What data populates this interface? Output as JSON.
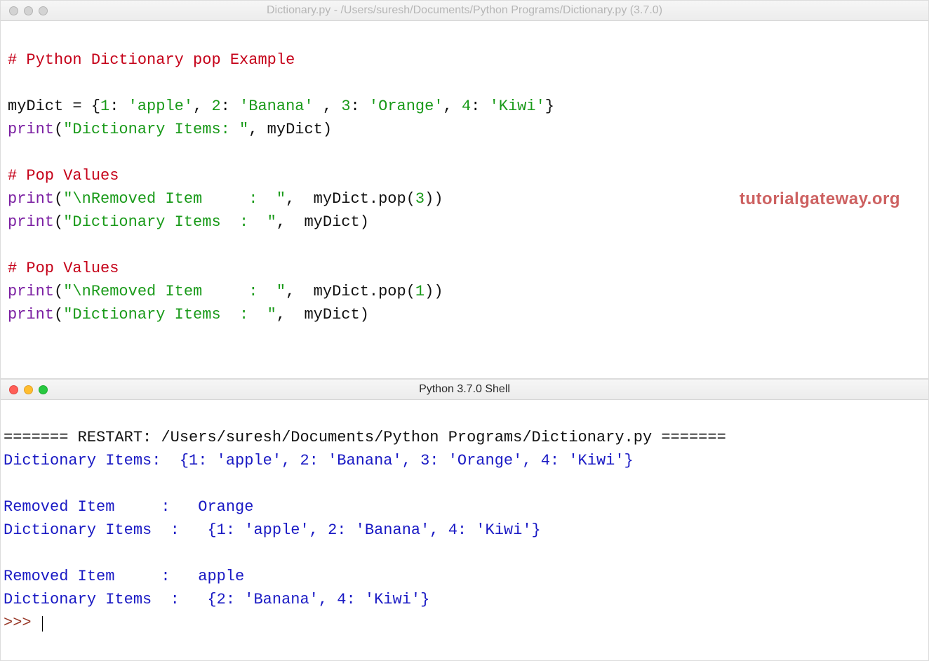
{
  "editor": {
    "title": "Dictionary.py - /Users/suresh/Documents/Python Programs/Dictionary.py (3.7.0)",
    "lines": {
      "l1_comment": "# Python Dictionary pop Example",
      "l2": "",
      "l3_assign_a": "myDict ",
      "l3_assign_b": "= {",
      "l3_k1": "1",
      "l3_c1": ": ",
      "l3_v1": "'apple'",
      "l3_s1": ", ",
      "l3_k2": "2",
      "l3_c2": ": ",
      "l3_v2": "'Banana'",
      "l3_s2": " , ",
      "l3_k3": "3",
      "l3_c3": ": ",
      "l3_v3": "'Orange'",
      "l3_s3": ", ",
      "l3_k4": "4",
      "l3_c4": ": ",
      "l3_v4": "'Kiwi'",
      "l3_end": "}",
      "l4_print": "print",
      "l4_open": "(",
      "l4_str": "\"Dictionary Items: \"",
      "l4_rest": ", myDict)",
      "l5": "",
      "l6_comment": "# Pop Values",
      "l7_print": "print",
      "l7_open": "(",
      "l7_str": "\"\\nRemoved Item     :  \"",
      "l7_rest": ",  myDict.pop(",
      "l7_arg": "3",
      "l7_close": "))",
      "l8_print": "print",
      "l8_open": "(",
      "l8_str": "\"Dictionary Items  :  \"",
      "l8_rest": ",  myDict)",
      "l9": "",
      "l10_comment": "# Pop Values",
      "l11_print": "print",
      "l11_open": "(",
      "l11_str": "\"\\nRemoved Item     :  \"",
      "l11_rest": ",  myDict.pop(",
      "l11_arg": "1",
      "l11_close": "))",
      "l12_print": "print",
      "l12_open": "(",
      "l12_str": "\"Dictionary Items  :  \"",
      "l12_rest": ",  myDict)"
    },
    "watermark": "tutorialgateway.org"
  },
  "shell": {
    "title": "Python 3.7.0 Shell",
    "restart": "======= RESTART: /Users/suresh/Documents/Python Programs/Dictionary.py =======",
    "out1": "Dictionary Items:  {1: 'apple', 2: 'Banana', 3: 'Orange', 4: 'Kiwi'}",
    "blank": "",
    "out2": "Removed Item     :   Orange",
    "out3": "Dictionary Items  :   {1: 'apple', 2: 'Banana', 4: 'Kiwi'}",
    "out4": "Removed Item     :   apple",
    "out5": "Dictionary Items  :   {2: 'Banana', 4: 'Kiwi'}",
    "prompt": ">>> "
  }
}
